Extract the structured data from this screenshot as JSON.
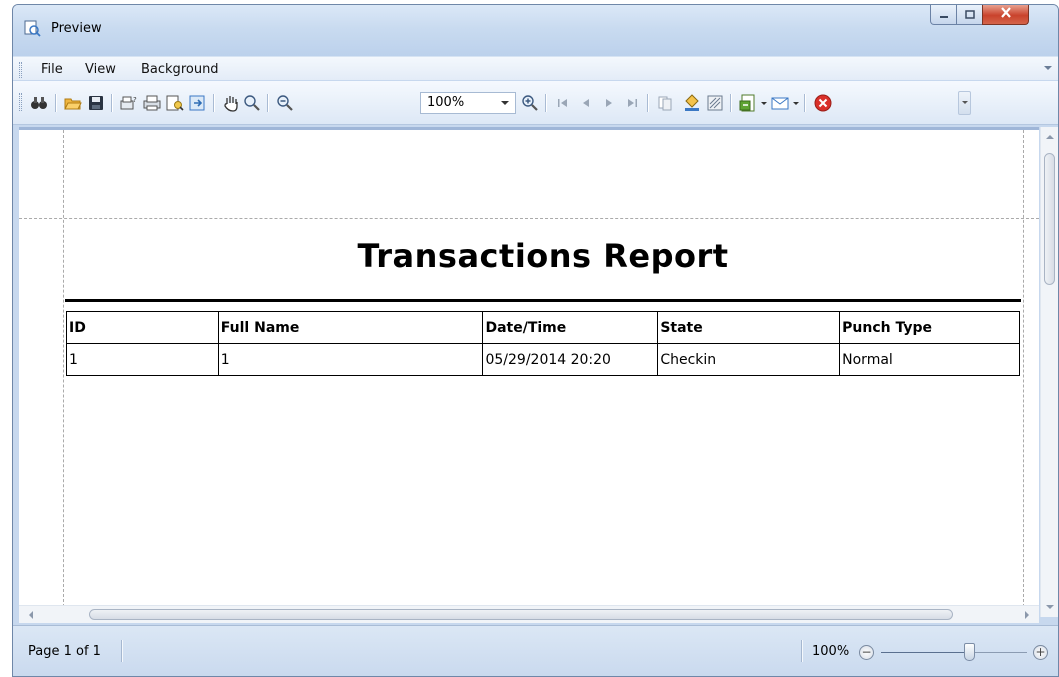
{
  "window": {
    "title": "Preview",
    "icon": "preview-icon"
  },
  "menu": {
    "items": [
      {
        "label": "File"
      },
      {
        "label": "View"
      },
      {
        "label": "Background"
      }
    ]
  },
  "toolbar": {
    "zoom_value": "100%",
    "icons": [
      "find-icon",
      "open-icon",
      "save-icon",
      "page-setup-icon",
      "print-icon",
      "print-preview-icon",
      "export-icon",
      "hand-tool-icon",
      "magnifier-icon",
      "zoom-out-icon",
      "zoom-in-icon",
      "first-page-icon",
      "previous-page-icon",
      "next-page-icon",
      "last-page-icon",
      "multiple-pages-icon",
      "page-color-icon",
      "watermark-icon",
      "export-document-icon",
      "send-email-icon",
      "close-preview-icon"
    ]
  },
  "report": {
    "title": "Transactions Report",
    "columns": [
      "ID",
      "Full Name",
      "Date/Time",
      "State",
      "Punch Type"
    ],
    "rows": [
      [
        "1",
        "1",
        "05/29/2014 20:20",
        "Checkin",
        "Normal"
      ]
    ]
  },
  "status": {
    "page": "Page 1 of 1",
    "zoom": "100%",
    "zoom_level_fraction": 0.6
  },
  "colors": {
    "window_frame": "#c7d8ee",
    "close_button": "#c9432c",
    "accent_blue": "#3b78c4"
  }
}
